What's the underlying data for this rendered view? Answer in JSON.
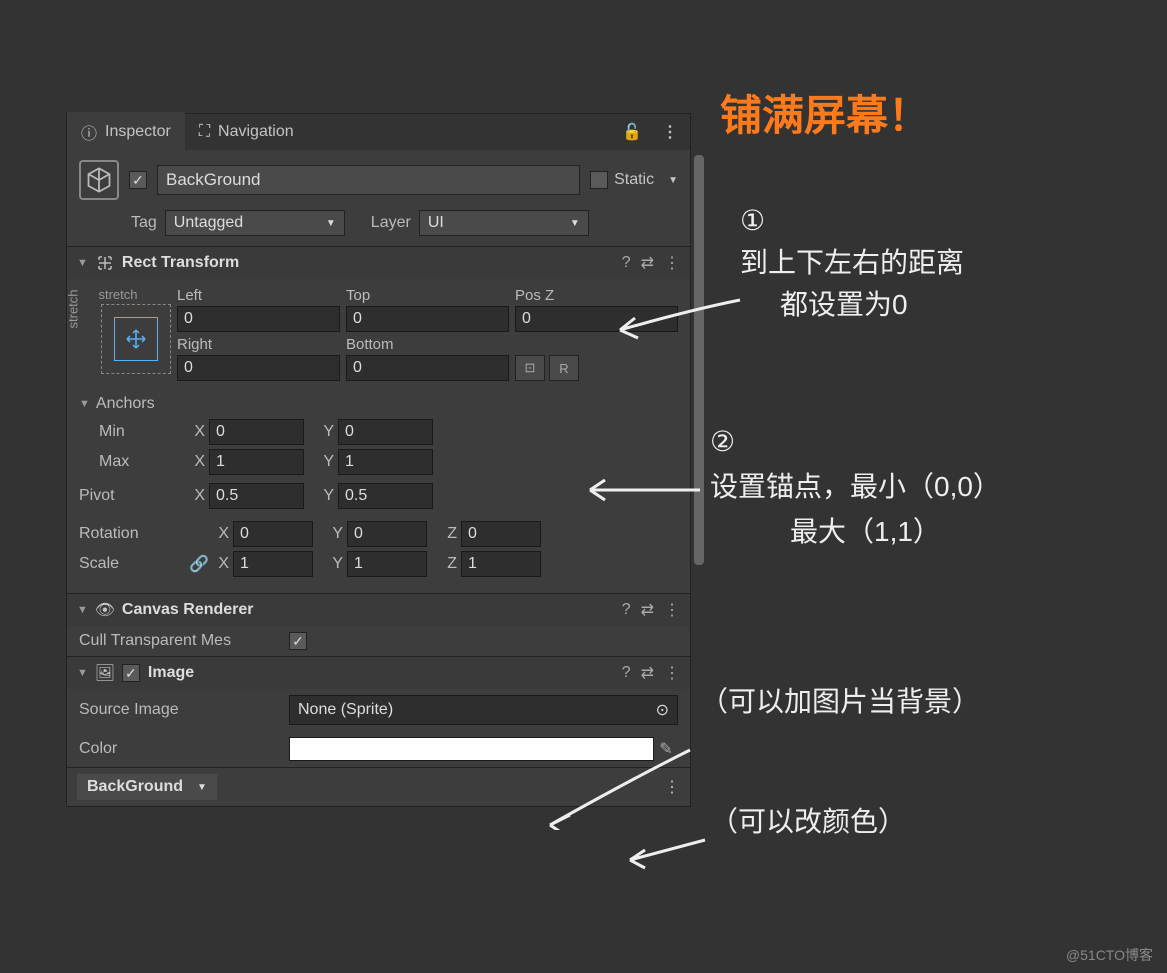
{
  "tabs": {
    "inspector": "Inspector",
    "navigation": "Navigation"
  },
  "obj": {
    "name": "BackGround",
    "static_label": "Static",
    "tag_label": "Tag",
    "tag_value": "Untagged",
    "layer_label": "Layer",
    "layer_value": "UI"
  },
  "rect": {
    "title": "Rect Transform",
    "stretch_h": "stretch",
    "stretch_v": "stretch",
    "labels": {
      "left": "Left",
      "top": "Top",
      "posz": "Pos Z",
      "right": "Right",
      "bottom": "Bottom"
    },
    "values": {
      "left": "0",
      "top": "0",
      "posz": "0",
      "right": "0",
      "bottom": "0"
    },
    "blueprint": "⊡",
    "raw": "R",
    "anchors_label": "Anchors",
    "min_label": "Min",
    "min_x": "0",
    "min_y": "0",
    "max_label": "Max",
    "max_x": "1",
    "max_y": "1",
    "pivot_label": "Pivot",
    "pivot_x": "0.5",
    "pivot_y": "0.5",
    "rotation_label": "Rotation",
    "rot_x": "0",
    "rot_y": "0",
    "rot_z": "0",
    "scale_label": "Scale",
    "scale_x": "1",
    "scale_y": "1",
    "scale_z": "1",
    "axis_x": "X",
    "axis_y": "Y",
    "axis_z": "Z"
  },
  "canvas": {
    "title": "Canvas Renderer",
    "cull_label": "Cull Transparent Mes"
  },
  "image": {
    "title": "Image",
    "source_label": "Source Image",
    "source_value": "None (Sprite)",
    "color_label": "Color"
  },
  "footer": {
    "dropdown": "BackGround"
  },
  "annotations": {
    "title": "铺满屏幕！",
    "note1_num": "①",
    "note1_a": "到上下左右的距离",
    "note1_b": "都设置为0",
    "note2_num": "②",
    "note2_a": "设置锚点，最小（0,0）",
    "note2_b": "最大（1,1）",
    "note3": "（可以加图片当背景）",
    "note4": "（可以改颜色）"
  },
  "watermark": "@51CTO博客"
}
